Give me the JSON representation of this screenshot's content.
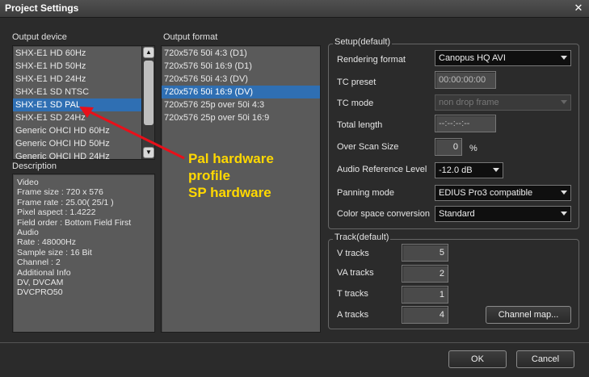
{
  "window": {
    "title": "Project Settings"
  },
  "output_device": {
    "label": "Output device",
    "items": [
      "SHX-E1 HD 60Hz",
      "SHX-E1 HD 50Hz",
      "SHX-E1 HD 24Hz",
      "SHX-E1 SD NTSC",
      "SHX-E1 SD PAL",
      "SHX-E1 SD 24Hz",
      "Generic OHCI HD 60Hz",
      "Generic OHCI HD 50Hz",
      "Generic OHCI HD 24Hz"
    ],
    "selected_index": 4
  },
  "output_format": {
    "label": "Output format",
    "items": [
      "720x576 50i 4:3 (D1)",
      "720x576 50i 16:9 (D1)",
      "720x576 50i 4:3 (DV)",
      "720x576 50i 16:9 (DV)",
      "720x576 25p over 50i 4:3",
      "720x576 25p over 50i 16:9"
    ],
    "selected_index": 3
  },
  "description": {
    "label": "Description",
    "lines": [
      "Video",
      "Frame size : 720 x 576",
      "Frame rate : 25.00( 25/1 )",
      "Pixel aspect : 1.4222",
      "Field order : Bottom Field First",
      "Audio",
      "Rate : 48000Hz",
      "Sample size : 16 Bit",
      "Channel : 2",
      "Additional Info",
      "DV, DVCAM",
      "DVCPRO50"
    ]
  },
  "annotation": {
    "lines": [
      "Pal hardware",
      "profile",
      "SP hardware"
    ],
    "color": "#ffd800",
    "arrow_color": "#e8101a"
  },
  "setup": {
    "title": "Setup(default)",
    "rendering_format": {
      "label": "Rendering format",
      "value": "Canopus HQ AVI"
    },
    "tc_preset": {
      "label": "TC preset",
      "value": "00:00:00:00"
    },
    "tc_mode": {
      "label": "TC mode",
      "value": "non drop frame"
    },
    "total_length": {
      "label": "Total length",
      "value": "--:--:--:--"
    },
    "over_scan": {
      "label": "Over Scan Size",
      "value": "0",
      "unit": "%"
    },
    "audio_ref": {
      "label": "Audio Reference Level",
      "value": "-12.0 dB"
    },
    "panning": {
      "label": "Panning mode",
      "value": "EDIUS Pro3 compatible"
    },
    "color_space": {
      "label": "Color space conversion",
      "value": "Standard"
    }
  },
  "track": {
    "title": "Track(default)",
    "v": {
      "label": "V tracks",
      "value": "5"
    },
    "va": {
      "label": "VA tracks",
      "value": "2"
    },
    "t": {
      "label": "T tracks",
      "value": "1"
    },
    "a": {
      "label": "A tracks",
      "value": "4"
    },
    "channel_map": "Channel map..."
  },
  "buttons": {
    "ok": "OK",
    "cancel": "Cancel"
  }
}
